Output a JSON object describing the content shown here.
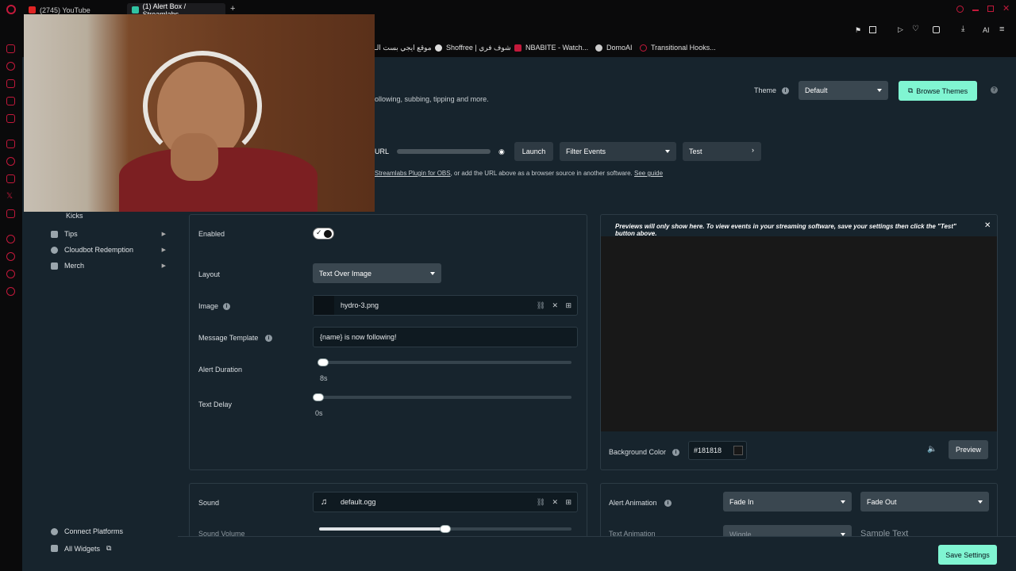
{
  "browser": {
    "tabs": [
      {
        "label": "(2745) YouTube"
      },
      {
        "label": "(1) Alert Box / Streamlabs"
      }
    ],
    "new_tab": "+",
    "bookmarks": [
      {
        "label": "موقع ايجي بست الـ"
      },
      {
        "label": "Shoffree | شوف فري"
      },
      {
        "label": "NBABITE - Watch..."
      },
      {
        "label": "DomoAI"
      },
      {
        "label": "Transitional Hooks..."
      }
    ],
    "toolbar_label": "AI"
  },
  "header": {
    "description": "ollowing, subbing, tipping and more.",
    "theme_label": "Theme",
    "theme_value": "Default",
    "browse_themes": "Browse Themes"
  },
  "url_row": {
    "url_label": "URL",
    "launch": "Launch",
    "filter_events": "Filter Events",
    "test": "Test",
    "hint_link": "Streamlabs Plugin for OBS",
    "hint_text": ", or add the URL above as a browser source in another software.",
    "see_guide": "See guide"
  },
  "sidebar": {
    "items": [
      {
        "label": "Kicks"
      },
      {
        "label": "Tips"
      },
      {
        "label": "Cloudbot Redemption"
      },
      {
        "label": "Merch"
      }
    ],
    "connect_platforms": "Connect Platforms",
    "all_widgets": "All Widgets"
  },
  "settings": {
    "enabled_label": "Enabled",
    "layout_label": "Layout",
    "layout_value": "Text Over Image",
    "image_label": "Image",
    "image_value": "hydro-3.png",
    "message_label": "Message Template",
    "message_value": "{name} is now following!",
    "duration_label": "Alert Duration",
    "duration_value": "8s",
    "delay_label": "Text Delay",
    "delay_value": "0s",
    "sound_label": "Sound",
    "sound_value": "default.ogg",
    "volume_label": "Sound Volume",
    "volume_level": 0.5
  },
  "preview": {
    "notice": "Previews will only show here. To view events in your streaming software, save your settings then click the \"Test\" button above.",
    "bg_label": "Background Color",
    "bg_value": "#181818",
    "preview_button": "Preview",
    "animation_label": "Alert Animation",
    "anim_in": "Fade In",
    "anim_out": "Fade Out",
    "text_animation_label": "Text Animation",
    "text_animation_value": "Wiggle",
    "sample_text": "Sample Text"
  },
  "footer": {
    "save": "Save Settings"
  },
  "colors": {
    "accent": "#80f5d2",
    "page": "#17242d",
    "brand_red": "#c3193b"
  }
}
